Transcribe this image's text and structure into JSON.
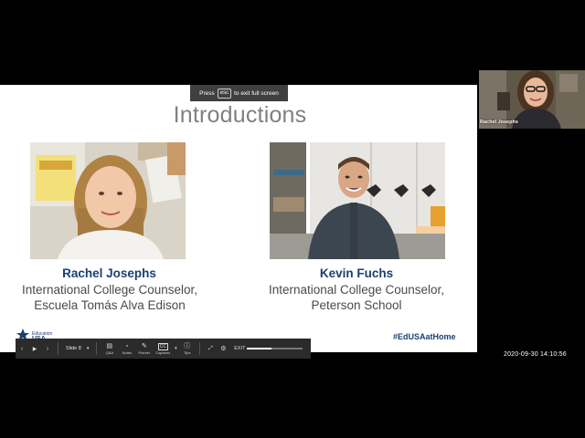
{
  "esc_hint": {
    "prefix": "Press",
    "key": "esc",
    "suffix": "to exit full screen"
  },
  "slide": {
    "title": "Introductions",
    "people": [
      {
        "name": "Rachel Josephs",
        "role_line1": "International College Counselor,",
        "role_line2": "Escuela Tomás Alva Edison"
      },
      {
        "name": "Kevin Fuchs",
        "role_line1": "International College Counselor,",
        "role_line2": "Peterson School"
      }
    ],
    "hashtag": "#EdUSAatHome",
    "logo_small": "Education",
    "logo_big": "USA"
  },
  "toolbar": {
    "prev_icon": "chevron-left-icon",
    "play_icon": "play-icon",
    "next_icon": "chevron-right-icon",
    "slide_label": "Slide 8",
    "tools": [
      {
        "icon": "qa-icon",
        "label": "Q&A"
      },
      {
        "icon": "notes-icon",
        "label": "Notes"
      },
      {
        "icon": "pointer-icon",
        "label": "Pointer"
      },
      {
        "icon": "captions-icon",
        "label": "Captions"
      },
      {
        "icon": "tips-icon",
        "label": "Tips"
      }
    ],
    "exit_label": "EXIT",
    "progress": 0.45
  },
  "participant": {
    "name": "Rachel Josephs"
  },
  "timestamp": "2020-09-30  14:10:56"
}
